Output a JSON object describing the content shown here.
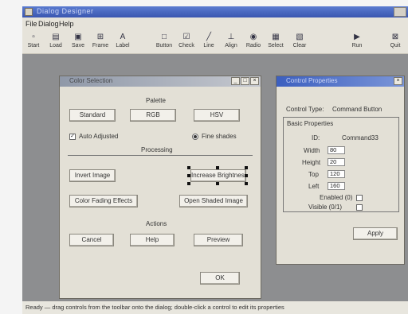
{
  "app": {
    "title": "Dialog Designer"
  },
  "menu": [
    "File",
    "Dialog",
    "Help"
  ],
  "toolbar": [
    {
      "label": "Start",
      "icon": "new-icon",
      "glyph": "▫"
    },
    {
      "label": "Load",
      "icon": "open-icon",
      "glyph": "▤"
    },
    {
      "label": "Save",
      "icon": "save-icon",
      "glyph": "▣"
    },
    {
      "label": "Frame",
      "icon": "frame-icon",
      "glyph": "⊞"
    },
    {
      "label": "Label",
      "icon": "label-icon",
      "glyph": "A"
    },
    {
      "label": "Button",
      "icon": "button-icon",
      "glyph": "□"
    },
    {
      "label": "Check",
      "icon": "check-icon",
      "glyph": "☑"
    },
    {
      "label": "Line",
      "icon": "line-icon",
      "glyph": "╱"
    },
    {
      "label": "Align",
      "icon": "align-icon",
      "glyph": "⊥"
    },
    {
      "label": "Radio",
      "icon": "radio-icon",
      "glyph": "◉"
    },
    {
      "label": "Select",
      "icon": "select-icon",
      "glyph": "▦"
    },
    {
      "label": "Clear",
      "icon": "clear-icon",
      "glyph": "▧"
    },
    {
      "label": "Run",
      "icon": "run-icon",
      "glyph": "▶"
    },
    {
      "label": "Quit",
      "icon": "quit-icon",
      "glyph": "⊠"
    }
  ],
  "dialog": {
    "title": "Color Selection",
    "section_palette": "Palette",
    "palette_buttons": [
      "Standard",
      "RGB",
      "HSV"
    ],
    "check_auto": "Auto Adjusted",
    "radio_shades": "Fine shades",
    "section_processing": "Processing",
    "proc_buttons": [
      "Invert Image",
      "Increase Brightness",
      "Color Fading Effects",
      "Open Shaded Image"
    ],
    "section_actions": "Actions",
    "action_buttons": [
      "Cancel",
      "Help",
      "Preview"
    ],
    "ok_label": "OK"
  },
  "props": {
    "title": "Control Properties",
    "control_type_label": "Control Type:",
    "control_type_value": "Command Button",
    "section": "Basic Properties",
    "id_label": "ID:",
    "id_value": "Command33",
    "rows": [
      {
        "label": "Width",
        "value": "80"
      },
      {
        "label": "Height",
        "value": "20"
      },
      {
        "label": "Top",
        "value": "120"
      },
      {
        "label": "Left",
        "value": "160"
      }
    ],
    "enabled_label": "Enabled (0)",
    "visible_label": "Visible (0/1)",
    "apply_label": "Apply"
  },
  "status": "Ready — drag controls from the toolbar onto the dialog; double-click a control to edit its properties"
}
